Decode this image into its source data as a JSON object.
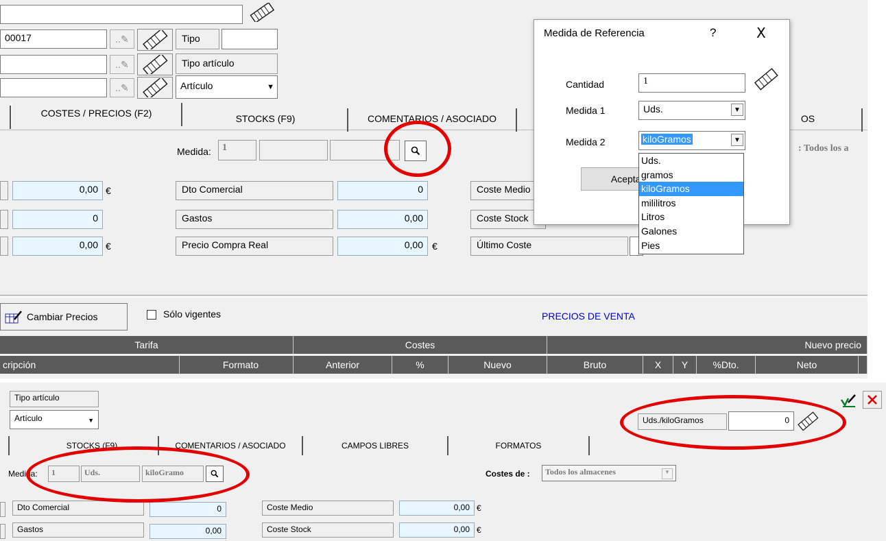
{
  "top": {
    "code_value": "00017",
    "tipo_label": "Tipo",
    "tipo_articulo_label": "Tipo artículo",
    "articulo_value": "Artículo"
  },
  "tabs": [
    "COSTES / PRECIOS (F2)",
    "STOCKS  (F9)",
    "COMENTARIOS / ASOCIADO",
    "OS"
  ],
  "medida": {
    "label": "Medida:",
    "value": "1"
  },
  "costes_right": ": Todos los a",
  "rows": [
    {
      "value": "0,00",
      "unit": "€",
      "label": "Dto Comercial",
      "value2": "0",
      "label3": "Coste Medio"
    },
    {
      "value": "0",
      "unit": "",
      "label": "Gastos",
      "value2": "0,00",
      "label3": "Coste Stock"
    },
    {
      "value": "0,00",
      "unit": "€",
      "label": "Precio Compra Real",
      "value2": "0,00",
      "unit2": "€",
      "label3": "Último Coste"
    }
  ],
  "toolbar": {
    "cambiar_precios": "Cambiar Precios",
    "solo_vigentes": "Sólo vigentes",
    "precios_venta": "PRECIOS DE VENTA"
  },
  "table": {
    "groups": [
      "Tarifa",
      "Costes",
      "Nuevo precio"
    ],
    "columns": [
      "cripción",
      "Formato",
      "Anterior",
      "%",
      "Nuevo",
      "Bruto",
      "X",
      "Y",
      "%Dto.",
      "Neto"
    ]
  },
  "dialog": {
    "title": "Medida de Referencia",
    "help": "?",
    "close": "X",
    "cantidad_label": "Cantidad",
    "cantidad_value": "1",
    "medida1_label": "Medida 1",
    "medida1_value": "Uds.",
    "medida2_label": "Medida 2",
    "medida2_value": "kiloGramos",
    "aceptar": "Aceptar",
    "options": [
      "Uds.",
      "gramos",
      "kiloGramos",
      "mililitros",
      "Litros",
      "Galones",
      "Pies"
    ],
    "selected_index": 2
  },
  "bottom": {
    "tipo_articulo_label": "Tipo artículo",
    "articulo_value": "Artículo",
    "ratio_label": "Uds./kiloGramos",
    "ratio_value": "0",
    "tabs": [
      "STOCKS  (F9)",
      "COMENTARIOS / ASOCIADO",
      "CAMPOS LIBRES",
      "FORMATOS"
    ],
    "medida_label": "Medida:",
    "medida_value": "1",
    "medida_u1": "Uds.",
    "medida_u2": "kiloGramo",
    "costes_de_label": "Costes de :",
    "costes_de_value": "Todos los almacenes",
    "rows": [
      {
        "label": "Dto Comercial",
        "value": "0",
        "label2": "Coste Medio",
        "value2": "0,00",
        "unit2": "€"
      },
      {
        "label": "Gastos",
        "value": "0,00",
        "label2": "Coste Stock",
        "value2": "0,00",
        "unit2": "€"
      }
    ]
  },
  "colors": {
    "annotation": "#e30000",
    "link_blue": "#0000cc",
    "selection": "#3399ff",
    "header_dark": "#5a5a5a"
  }
}
